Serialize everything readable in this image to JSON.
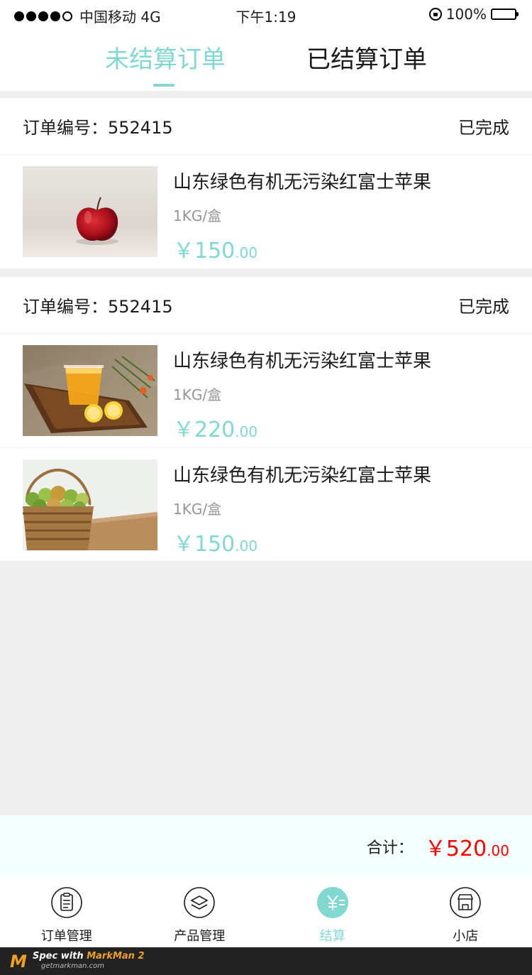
{
  "status_bar": {
    "carrier": "中国移动 4G",
    "time": "下午1:19",
    "battery": "100%"
  },
  "tabs": [
    {
      "label": "未结算订单",
      "active": true
    },
    {
      "label": "已结算订单",
      "active": false
    }
  ],
  "orders": [
    {
      "number": "订单编号：552415",
      "status": "已完成",
      "items": [
        {
          "title": "山东绿色有机无污染红富士苹果",
          "spec": "1KG/盒",
          "price_int": "￥150",
          "price_dec": ".00",
          "image": "apple"
        }
      ]
    },
    {
      "number": "订单编号：552415",
      "status": "已完成",
      "items": [
        {
          "title": "山东绿色有机无污染红富士苹果",
          "spec": "1KG/盒",
          "price_int": "￥220",
          "price_dec": ".00",
          "image": "orange-juice"
        },
        {
          "title": "山东绿色有机无污染红富士苹果",
          "spec": "1KG/盒",
          "price_int": "￥150",
          "price_dec": ".00",
          "image": "apple-basket"
        }
      ]
    }
  ],
  "total": {
    "label": "合计：",
    "price_int": "￥520",
    "price_dec": ".00"
  },
  "tabbar": [
    {
      "label": "订单管理",
      "icon": "clipboard-icon",
      "active": false
    },
    {
      "label": "产品管理",
      "icon": "layers-icon",
      "active": false
    },
    {
      "label": "结算",
      "icon": "yen-icon",
      "active": true
    },
    {
      "label": "小店",
      "icon": "shop-icon",
      "active": false
    }
  ],
  "watermark": {
    "title_prefix": "Spec with ",
    "title_accent": "MarkMan 2",
    "url": "getmarkman.com"
  },
  "colors": {
    "accent": "#81d8d0",
    "text": "#1b1b1b",
    "muted": "#959595",
    "divider": "#eeeeee",
    "total_bg": "#f5fffe",
    "total_price": "#ff0000"
  }
}
